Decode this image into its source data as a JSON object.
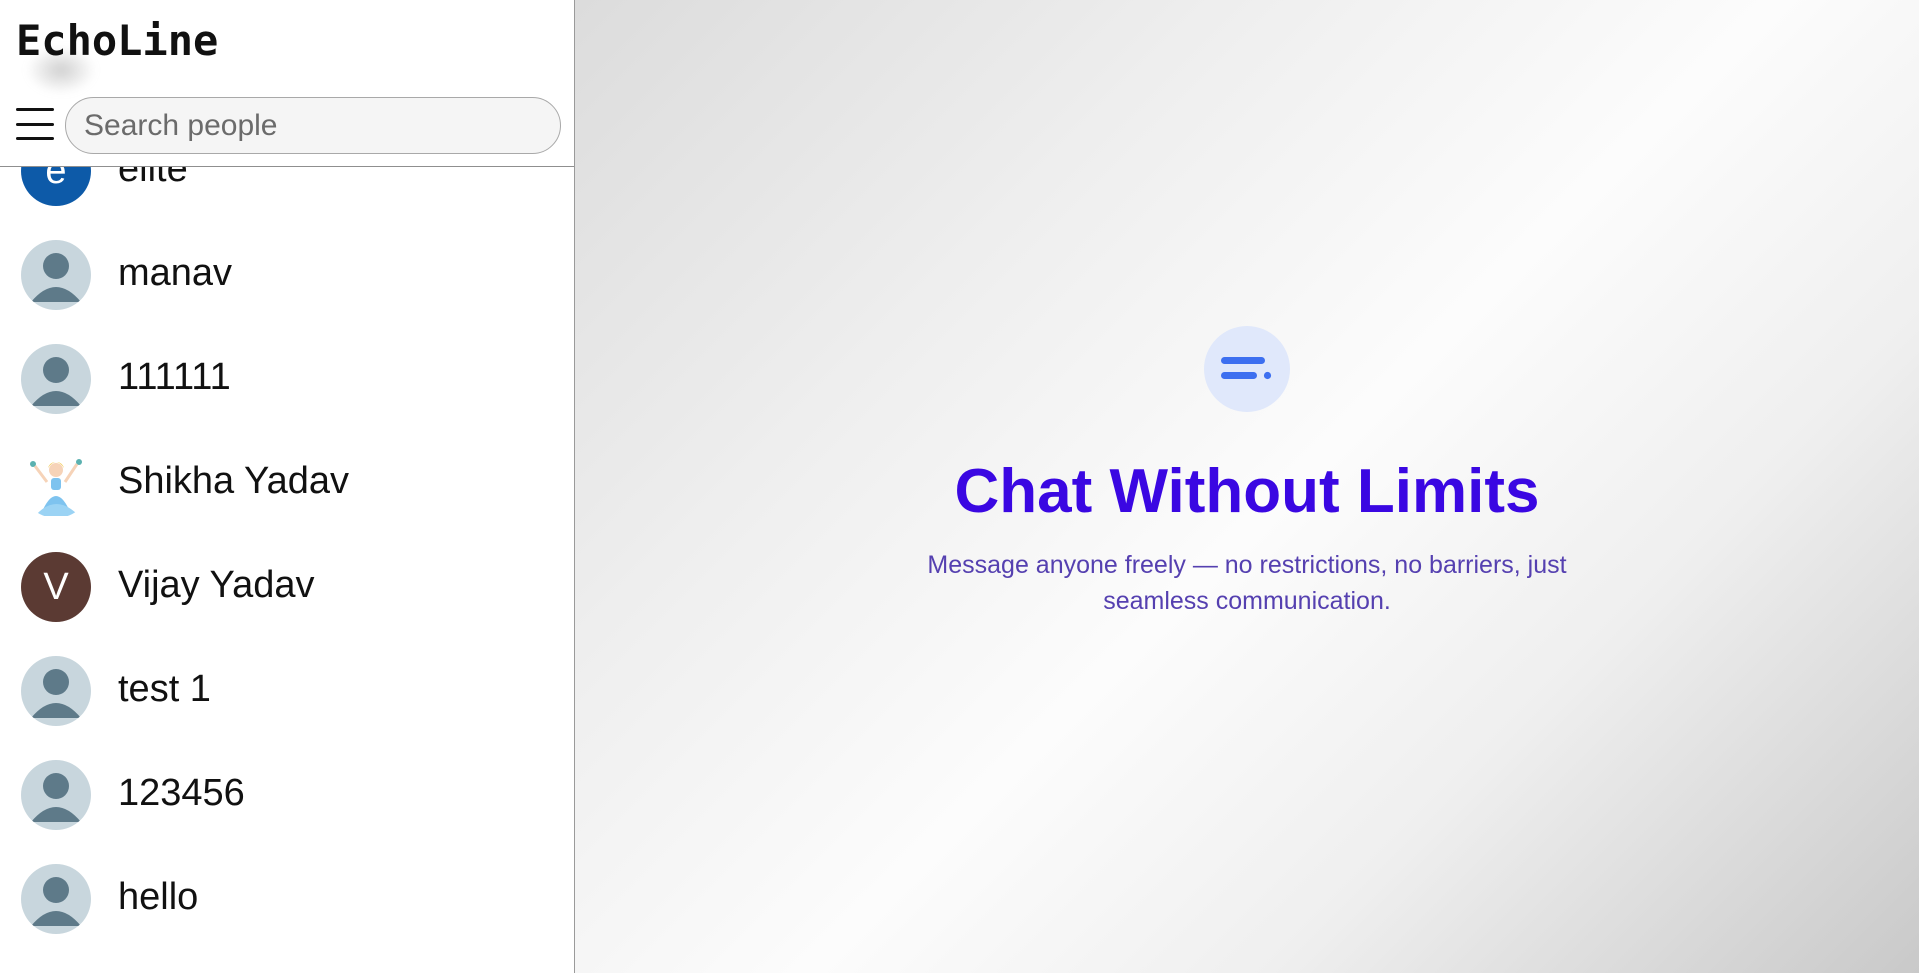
{
  "app": {
    "brand": "EchoLine"
  },
  "search": {
    "placeholder": "Search people"
  },
  "contacts": [
    {
      "name": "elite",
      "avatar": {
        "type": "letter",
        "letter": "e",
        "color": "#0d5aa8"
      }
    },
    {
      "name": "manav",
      "avatar": {
        "type": "default"
      }
    },
    {
      "name": "111111",
      "avatar": {
        "type": "default"
      }
    },
    {
      "name": "Shikha Yadav",
      "avatar": {
        "type": "image",
        "icon": "princess-illustration"
      }
    },
    {
      "name": "Vijay Yadav",
      "avatar": {
        "type": "letter",
        "letter": "V",
        "color": "#5b3a33"
      }
    },
    {
      "name": "test 1",
      "avatar": {
        "type": "default"
      }
    },
    {
      "name": "123456",
      "avatar": {
        "type": "default"
      }
    },
    {
      "name": "hello",
      "avatar": {
        "type": "default"
      }
    }
  ],
  "welcome": {
    "icon": "chat-lines-icon",
    "title": "Chat Without Limits",
    "subtitle": "Message anyone freely — no restrictions, no barriers, just seamless communication."
  },
  "colors": {
    "title": "#3a07e2",
    "subtitle": "#5540b0",
    "badge_bg": "#e0e8fb",
    "badge_icon": "#3d6ff0",
    "default_avatar_bg": "#c8d6dd",
    "default_avatar_fg": "#5e7a89"
  }
}
